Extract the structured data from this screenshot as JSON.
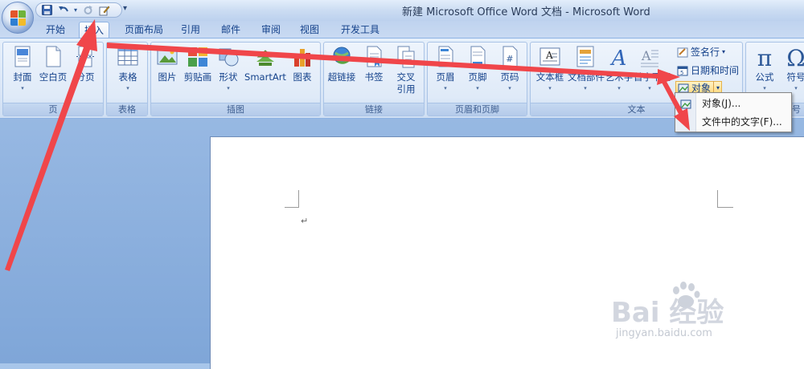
{
  "window": {
    "title": "新建 Microsoft Office Word 文档 - Microsoft Word"
  },
  "qat": {
    "more": "▾"
  },
  "tabs": [
    "开始",
    "插入",
    "页面布局",
    "引用",
    "邮件",
    "审阅",
    "视图",
    "开发工具"
  ],
  "groups": {
    "page": {
      "label": "页",
      "items": [
        "封面",
        "空白页",
        "分页"
      ]
    },
    "table": {
      "label": "表格",
      "items": [
        "表格"
      ]
    },
    "illustrations": {
      "label": "插图",
      "items": [
        "图片",
        "剪贴画",
        "形状",
        "SmartArt",
        "图表"
      ]
    },
    "links": {
      "label": "链接",
      "items": [
        "超链接",
        "书签",
        "交叉",
        "引用"
      ]
    },
    "header_footer": {
      "label": "页眉和页脚",
      "items": [
        "页眉",
        "页脚",
        "页码"
      ]
    },
    "text": {
      "label": "文本",
      "items": [
        "文本框",
        "文档部件",
        "艺术字",
        "首字下沉"
      ],
      "small": [
        "签名行",
        "日期和时间",
        "对象"
      ]
    },
    "symbols": {
      "label": "符号",
      "items": [
        "公式",
        "符号"
      ]
    }
  },
  "menu": {
    "items": [
      "对象(J)...",
      "文件中的文字(F)..."
    ]
  },
  "document": {
    "paragraph_mark": "↵"
  },
  "watermark": {
    "brand": "Bai 经验",
    "url": "jingyan.baidu.com"
  },
  "colors": {
    "arrow": "#f0464a",
    "ribbon_text": "#15428b"
  }
}
